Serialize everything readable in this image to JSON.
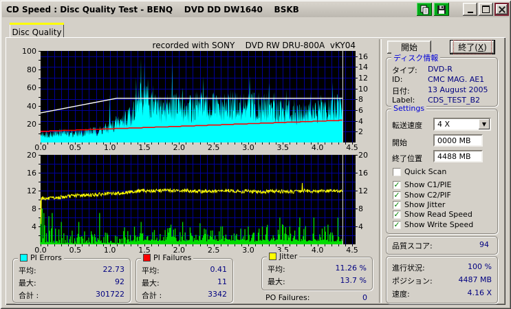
{
  "window": {
    "title": "CD Speed : Disc Quality Test - BENQ    DVD DD DW1640    BSKB"
  },
  "icons": {
    "copy": "copy-pages",
    "save": "floppy-disk",
    "minimize": "minimize",
    "maximize": "maximize",
    "close": "close",
    "dropdown": "▼",
    "check": "✓"
  },
  "tab": {
    "label": "Disc Quality"
  },
  "buttons": {
    "start": "開始",
    "exit_pre": "終了(",
    "exit_key": "X",
    "exit_post": ")"
  },
  "disc_info": {
    "title": "ディスク情報",
    "rows": [
      {
        "label": "タイプ:",
        "value": "DVD-R"
      },
      {
        "label": "ID:",
        "value": "CMC MAG. AE1"
      },
      {
        "label": "日付:",
        "value": "13 August 2005"
      },
      {
        "label": "Label:",
        "value": "CDS_TEST_B2"
      }
    ]
  },
  "settings": {
    "title": "Settings",
    "speed_label": "転送速度",
    "speed_value": "4 X",
    "start_label": "開始",
    "start_value": "0000 MB",
    "end_label": "終了位置",
    "end_value": "4488 MB",
    "checkboxes": [
      {
        "label": "Quick Scan",
        "checked": false
      },
      {
        "label": "Show C1/PIE",
        "checked": true
      },
      {
        "label": "Show C2/PIF",
        "checked": true
      },
      {
        "label": "Show Jitter",
        "checked": true
      },
      {
        "label": "Show Read Speed",
        "checked": true
      },
      {
        "label": "Show Write Speed",
        "checked": true
      }
    ]
  },
  "quality": {
    "label": "品質スコア:",
    "value": "94"
  },
  "progress": {
    "rows": [
      {
        "label": "進行状況:",
        "value": "100 %"
      },
      {
        "label": "ポジション:",
        "value": "4487 MB"
      },
      {
        "label": "速度:",
        "value": "4.16 X"
      }
    ]
  },
  "stats": [
    {
      "id": "pi-errors",
      "title": "PI Errors",
      "color": "#00ffff",
      "rows": [
        {
          "label": "平均:",
          "value": "22.73"
        },
        {
          "label": "最大:",
          "value": "92"
        },
        {
          "label": "合計 :",
          "value": "301722"
        }
      ]
    },
    {
      "id": "pi-failures",
      "title": "PI Failures",
      "color": "#ff0000",
      "rows": [
        {
          "label": "平均:",
          "value": "0.41"
        },
        {
          "label": "最大:",
          "value": "11"
        },
        {
          "label": "合計 :",
          "value": "3342"
        }
      ]
    },
    {
      "id": "jitter",
      "title": "Jitter",
      "color": "#ffff00",
      "rows": [
        {
          "label": "平均:",
          "value": "11.26 %"
        },
        {
          "label": "最大:",
          "value": "13.7 %"
        }
      ]
    }
  ],
  "po_failures": {
    "label": "PO Failures:",
    "value": "0"
  },
  "chart_data": [
    {
      "type": "area",
      "title": "recorded with SONY    DVD RW DRU-800A  vKY04",
      "x_tick_labels": [
        "0.0",
        "0.5",
        "1.0",
        "1.5",
        "2.0",
        "2.5",
        "3.0",
        "3.5",
        "4.0",
        "4.5"
      ],
      "x_tick_values": [
        0,
        0.5,
        1,
        1.5,
        2,
        2.5,
        3,
        3.5,
        4,
        4.5
      ],
      "x_range": [
        0,
        4.55
      ],
      "end_x": 4.36,
      "left_axis": {
        "range": [
          0,
          100
        ],
        "ticks": [
          20,
          40,
          60,
          80,
          100
        ],
        "minor_step": 10
      },
      "right_axis": {
        "range": [
          0,
          17
        ],
        "ticks": [
          2,
          4,
          6,
          8,
          10,
          12,
          14,
          16
        ],
        "grid_step": 2
      },
      "bg": "#000000",
      "grid_color": "#00009b",
      "marker_color": "#e6e6e6",
      "series": [
        {
          "name": "PI Errors",
          "kind": "noisy-area",
          "axis": "left",
          "color": "#00ffff",
          "anchor_step": 0.1,
          "anchors": [
            9,
            9,
            10,
            11,
            10,
            10,
            11,
            12,
            12,
            14,
            16,
            21,
            26,
            30,
            44,
            50,
            40,
            36,
            38,
            40,
            38,
            36,
            38,
            40,
            36,
            38,
            36,
            38,
            40,
            36,
            40,
            38,
            36,
            40,
            38,
            36,
            34,
            33,
            34,
            33,
            32,
            33,
            36,
            38
          ],
          "noise": 0.9,
          "spikes": [
            [
              1.0,
              52
            ],
            [
              1.38,
              71
            ],
            [
              1.45,
              92
            ],
            [
              1.5,
              88
            ],
            [
              1.55,
              70
            ],
            [
              1.62,
              63
            ],
            [
              1.9,
              87
            ],
            [
              2.05,
              60
            ],
            [
              2.35,
              72
            ],
            [
              2.5,
              55
            ],
            [
              2.75,
              58
            ],
            [
              3.02,
              73
            ],
            [
              3.15,
              55
            ],
            [
              3.3,
              65
            ],
            [
              3.55,
              58
            ],
            [
              3.9,
              55
            ],
            [
              4.05,
              52
            ],
            [
              4.22,
              66
            ]
          ]
        },
        {
          "name": "Read Speed",
          "kind": "step-line",
          "axis": "right",
          "color": "#ff0000",
          "points": [
            [
              0,
              2.1
            ],
            [
              4.36,
              4.16
            ]
          ],
          "step_quantum": 0.09
        },
        {
          "name": "Write Speed",
          "kind": "line",
          "axis": "right",
          "color": "#ffffff",
          "points": [
            [
              0,
              5.5
            ],
            [
              1.1,
              8.2
            ],
            [
              4.36,
              8.2
            ]
          ]
        }
      ]
    },
    {
      "type": "bar",
      "x_tick_labels": [
        "0.0",
        "0.5",
        "1.0",
        "1.5",
        "2.0",
        "2.5",
        "3.0",
        "3.5",
        "4.0",
        "4.5"
      ],
      "x_tick_values": [
        0,
        0.5,
        1,
        1.5,
        2,
        2.5,
        3,
        3.5,
        4,
        4.5
      ],
      "x_range": [
        0,
        4.55
      ],
      "end_x": 4.36,
      "left_axis": {
        "range": [
          0,
          20
        ],
        "ticks": [
          4,
          8,
          12,
          16,
          20
        ],
        "minor_step": 2
      },
      "right_axis": {
        "range": [
          0,
          20
        ],
        "ticks": [
          4,
          8,
          12,
          16,
          20
        ],
        "grid_step": 2
      },
      "bg": "#000000",
      "grid_color": "#00009b",
      "marker_color": "#e6e6e6",
      "series": [
        {
          "name": "PI Failures",
          "kind": "noisy-bars",
          "axis": "left",
          "color": "#00dc00",
          "anchor_step": 0.1,
          "anchors": [
            3,
            3,
            2.5,
            1.5,
            1,
            1.5,
            1.2,
            1.5,
            1.2,
            2,
            1,
            0.8,
            1.5,
            1.5,
            1.8,
            1.8,
            1.5,
            1.5,
            1.5,
            1.8,
            1.5,
            1.5,
            1.5,
            1.8,
            1.5,
            1.5,
            1.8,
            1.5,
            1.5,
            1.5,
            1.5,
            1.8,
            1.5,
            1.8,
            1.5,
            1.8,
            1.5,
            1.8,
            2,
            1.8,
            1.5,
            1.8,
            1.8,
            2
          ],
          "baseline_from": 1.25,
          "baseline": 1,
          "spikes": [
            [
              0.02,
              8
            ],
            [
              0.05,
              7
            ],
            [
              0.17,
              7
            ],
            [
              0.3,
              5
            ],
            [
              0.55,
              5
            ],
            [
              0.85,
              7
            ],
            [
              1.35,
              6
            ],
            [
              1.45,
              5
            ],
            [
              2.05,
              5
            ],
            [
              2.3,
              4.7
            ],
            [
              2.6,
              4
            ],
            [
              3.0,
              4
            ],
            [
              3.2,
              4
            ],
            [
              3.45,
              6
            ],
            [
              3.6,
              4
            ],
            [
              3.75,
              6
            ],
            [
              3.95,
              6
            ],
            [
              4.1,
              4
            ],
            [
              4.3,
              6
            ]
          ]
        },
        {
          "name": "Jitter",
          "kind": "noisy-line",
          "axis": "left",
          "color": "#ffff00",
          "anchor_step": 0.1,
          "anchors": [
            10.4,
            10.2,
            10.3,
            10.5,
            10.7,
            10.9,
            11.0,
            11.0,
            11.1,
            11.2,
            11.3,
            11.4,
            11.5,
            11.7,
            11.9,
            12.0,
            11.9,
            12.0,
            12.1,
            12.0,
            11.9,
            12.0,
            11.9,
            11.8,
            11.9,
            11.8,
            11.9,
            12.0,
            11.9,
            11.8,
            11.9,
            11.8,
            11.7,
            11.8,
            11.9,
            11.8,
            11.7,
            11.8,
            12.0,
            11.9,
            11.8,
            11.9,
            12.0,
            11.8
          ],
          "noise": 0.8,
          "spikes": [
            [
              0.004,
              4.5
            ],
            [
              3.78,
              13.7
            ]
          ]
        }
      ]
    }
  ]
}
